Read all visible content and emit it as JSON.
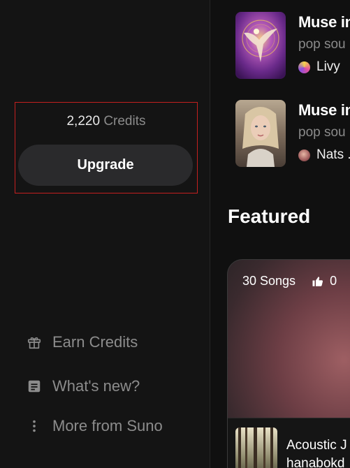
{
  "credits": {
    "amount": "2,220",
    "label": "Credits",
    "upgrade_label": "Upgrade"
  },
  "menu": {
    "earn": {
      "label": "Earn Credits",
      "icon": "gift-icon"
    },
    "whats_new": {
      "label": "What's new?",
      "icon": "document-icon"
    },
    "more": {
      "label": "More from Suno",
      "icon": "kebab-vertical-icon"
    }
  },
  "songs": [
    {
      "title": "Muse in",
      "genre": "pop sou",
      "artist": "Livy"
    },
    {
      "title": "Muse in",
      "genre": "pop sou",
      "artist": "Nats ."
    }
  ],
  "featured": {
    "heading": "Featured",
    "playlist": {
      "song_count": "30 Songs",
      "likes": "0",
      "name": "Acoustic J",
      "artist": "hanabokd"
    }
  },
  "colors": {
    "highlight_border": "#c4201f",
    "button_bg": "#2a2a2c",
    "muted_text": "#8c8c8c"
  }
}
